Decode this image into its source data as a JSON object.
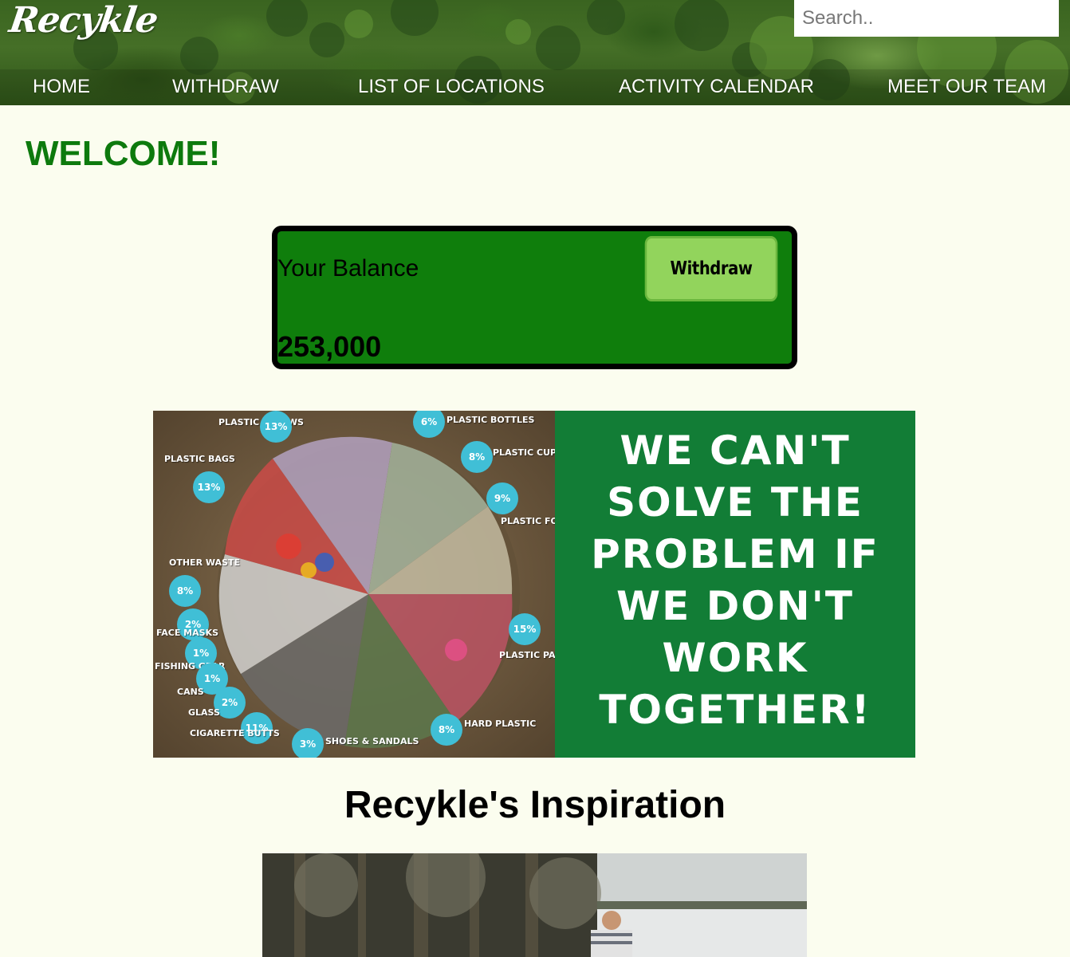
{
  "header": {
    "logo_text": "Recykle",
    "search_placeholder": "Search..",
    "nav": [
      {
        "label": "HOME"
      },
      {
        "label": "WITHDRAW"
      },
      {
        "label": "LIST OF LOCATIONS"
      },
      {
        "label": "ACTIVITY CALENDAR"
      },
      {
        "label": "MEET OUR TEAM"
      }
    ]
  },
  "welcome": {
    "title": "WELCOME!"
  },
  "balance": {
    "label": "Your Balance",
    "amount": "253,000",
    "withdraw_label": "Withdraw"
  },
  "banner": {
    "slogan_lines": [
      "WE CAN'T",
      "SOLVE THE",
      "PROBLEM IF",
      "WE DON'T",
      "WORK",
      "TOGETHER!"
    ],
    "segments": [
      {
        "label": "PLASTIC STRAWS",
        "percent": "13%"
      },
      {
        "label": "PLASTIC BOTTLES",
        "percent": "6%"
      },
      {
        "label": "PLASTIC CUPS",
        "percent": "8%"
      },
      {
        "label": "PLASTIC BAGS",
        "percent": "13%"
      },
      {
        "label": "PLASTIC FOOD TAKEAWAY",
        "percent": "9%"
      },
      {
        "label": "OTHER WASTE",
        "percent": "8%"
      },
      {
        "label": "FACE MASKS",
        "percent": "2%"
      },
      {
        "label": "FISHING GEAR",
        "percent": "1%"
      },
      {
        "label": "CANS",
        "percent": "1%"
      },
      {
        "label": "GLASS",
        "percent": "2%"
      },
      {
        "label": "PLASTIC PACKAGING",
        "percent": "15%"
      },
      {
        "label": "CIGARETTE BUTTS",
        "percent": "11%"
      },
      {
        "label": "SHOES & SANDALS",
        "percent": "3%"
      },
      {
        "label": "HARD PLASTIC",
        "percent": "8%"
      }
    ]
  },
  "inspiration": {
    "title": "Recykle's Inspiration"
  },
  "colors": {
    "page_bg": "#fbfdef",
    "welcome_green": "#0d7a0d",
    "card_green": "#0f7e0c",
    "button_green": "#92d45c",
    "banner_green": "#127d36",
    "bubble_cyan": "#40bfd6"
  }
}
